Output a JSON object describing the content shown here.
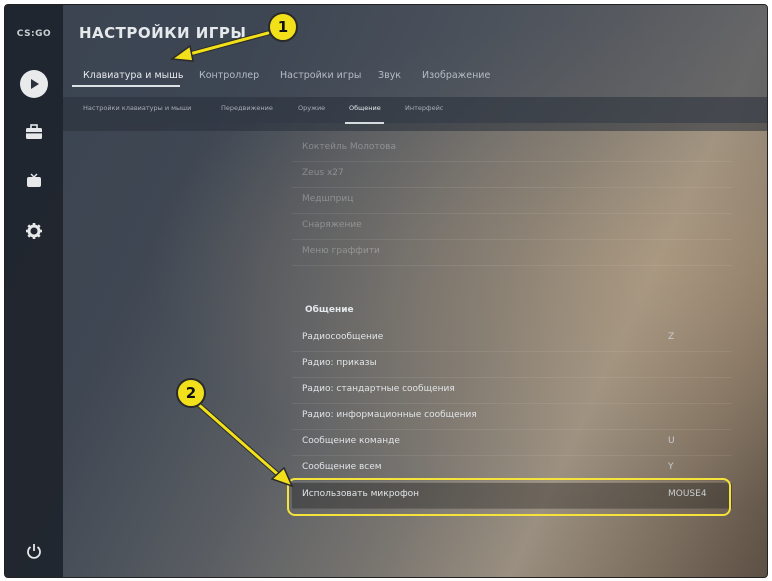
{
  "sidebar": {
    "logo": "CS:GO",
    "icons": [
      "play-icon",
      "briefcase-icon",
      "tv-icon",
      "gear-icon",
      "power-icon"
    ]
  },
  "header": {
    "title": "НАСТРОЙКИ ИГРЫ",
    "tabs": [
      {
        "label": "Клавиатура и мышь",
        "active": true
      },
      {
        "label": "Контроллер"
      },
      {
        "label": "Настройки игры"
      },
      {
        "label": "Звук"
      },
      {
        "label": "Изображение"
      }
    ]
  },
  "subtabs": [
    {
      "label": "Настройки клавиатуры и мыши"
    },
    {
      "label": "Передвижение"
    },
    {
      "label": "Оружие"
    },
    {
      "label": "Общение",
      "active": true
    },
    {
      "label": "Интерфейс"
    }
  ],
  "faded_rows": [
    {
      "name": "Коктейль Молотова",
      "key": ""
    },
    {
      "name": "Zeus x27",
      "key": ""
    },
    {
      "name": "Медшприц",
      "key": ""
    },
    {
      "name": "Снаряжение",
      "key": ""
    },
    {
      "name": "Меню граффити",
      "key": ""
    }
  ],
  "section_title": "Общение",
  "rows": [
    {
      "name": "Радиосообщение",
      "key": "Z"
    },
    {
      "name": "Радио: приказы",
      "key": ""
    },
    {
      "name": "Радио: стандартные сообщения",
      "key": ""
    },
    {
      "name": "Радио: информационные сообщения",
      "key": ""
    },
    {
      "name": "Сообщение команде",
      "key": "U"
    },
    {
      "name": "Сообщение всем",
      "key": "Y"
    },
    {
      "name": "Использовать микрофон",
      "key": "MOUSE4"
    }
  ],
  "annotations": {
    "badge1": "1",
    "badge2": "2",
    "color": "#f2e11a"
  }
}
